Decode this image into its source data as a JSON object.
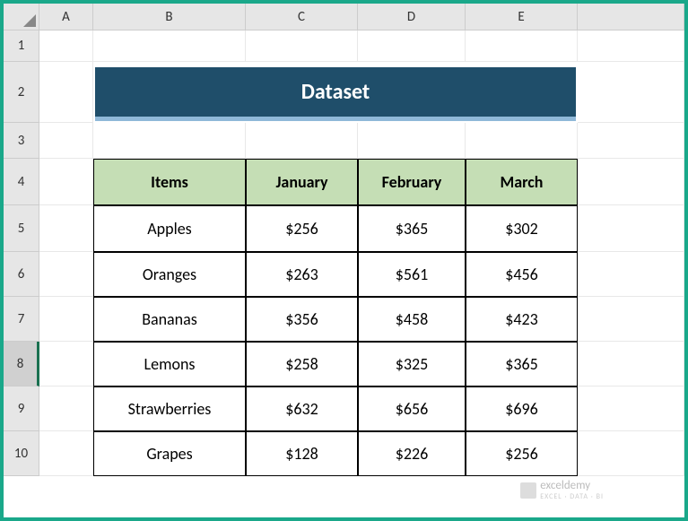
{
  "columns": [
    "A",
    "B",
    "C",
    "D",
    "E"
  ],
  "rows": [
    "1",
    "2",
    "3",
    "4",
    "5",
    "6",
    "7",
    "8",
    "9",
    "10"
  ],
  "selected_row": "8",
  "title": "Dataset",
  "table": {
    "headers": [
      "Items",
      "January",
      "February",
      "March"
    ],
    "rows": [
      {
        "item": "Apples",
        "jan": "$256",
        "feb": "$365",
        "mar": "$302"
      },
      {
        "item": "Oranges",
        "jan": "$263",
        "feb": "$561",
        "mar": "$456"
      },
      {
        "item": "Bananas",
        "jan": "$356",
        "feb": "$458",
        "mar": "$423"
      },
      {
        "item": "Lemons",
        "jan": "$258",
        "feb": "$325",
        "mar": "$365"
      },
      {
        "item": "Strawberries",
        "jan": "$632",
        "feb": "$656",
        "mar": "$696"
      },
      {
        "item": "Grapes",
        "jan": "$128",
        "feb": "$226",
        "mar": "$256"
      }
    ]
  },
  "watermark": {
    "brand": "exceldemy",
    "tagline": "EXCEL · DATA · BI"
  },
  "chart_data": {
    "type": "table",
    "title": "Dataset",
    "columns": [
      "Items",
      "January",
      "February",
      "March"
    ],
    "rows": [
      [
        "Apples",
        256,
        365,
        302
      ],
      [
        "Oranges",
        263,
        561,
        456
      ],
      [
        "Bananas",
        356,
        458,
        423
      ],
      [
        "Lemons",
        258,
        325,
        365
      ],
      [
        "Strawberries",
        632,
        656,
        696
      ],
      [
        "Grapes",
        128,
        226,
        256
      ]
    ]
  }
}
